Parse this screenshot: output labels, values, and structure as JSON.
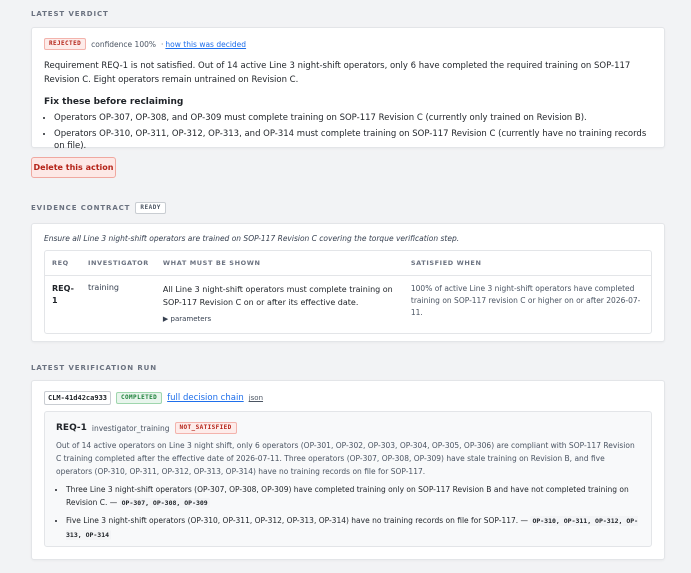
{
  "latest_verdict": {
    "section_label": "LATEST VERDICT",
    "status_pill": "REJECTED",
    "confidence": "confidence 100%",
    "separator": "·",
    "how_decided_link": "how this was decided",
    "summary": "Requirement REQ-1 is not satisfied. Out of 14 active Line 3 night-shift operators, only 6 have completed the required training on SOP-117 Revision C. Eight operators remain untrained on Revision C.",
    "fix_heading": "Fix these before reclaiming",
    "fix_items": [
      "Operators OP-307, OP-308, and OP-309 must complete training on SOP-117 Revision C (currently only trained on Revision B).",
      "Operators OP-310, OP-311, OP-312, OP-313, and OP-314 must complete training on SOP-117 Revision C (currently have no training records on file)."
    ],
    "delete_button": "Delete this action"
  },
  "evidence_contract": {
    "section_label": "EVIDENCE CONTRACT",
    "status_pill": "READY",
    "description": "Ensure all Line 3 night-shift operators are trained on SOP-117 Revision C covering the torque verification step.",
    "columns": [
      "REQ",
      "INVESTIGATOR",
      "WHAT MUST BE SHOWN",
      "SATISFIED WHEN"
    ],
    "rows": [
      {
        "req": "REQ-1",
        "investigator": "training",
        "what": "All Line 3 night-shift operators must complete training on SOP-117 Revision C on or after its effective date.",
        "params": "▶ parameters",
        "satisfied": "100% of active Line 3 night-shift operators have completed training on SOP-117 revision C or higher on or after 2026-07-11."
      }
    ]
  },
  "verification_run": {
    "section_label": "LATEST VERIFICATION RUN",
    "run_id": "CLM-41d42ca933",
    "status_pill": "COMPLETED",
    "decision_chain_link": "full decision chain",
    "json_link": "json",
    "result": {
      "req": "REQ-1",
      "investigator": "investigator_training",
      "status_pill": "NOT_SATISFIED",
      "summary": "Out of 14 active operators on Line 3 night shift, only 6 operators (OP-301, OP-302, OP-303, OP-304, OP-305, OP-306) are compliant with SOP-117 Revision C training completed after the effective date of 2026-07-11. Three operators (OP-307, OP-308, OP-309) have stale training on Revision B, and five operators (OP-310, OP-311, OP-312, OP-313, OP-314) have no training records on file for SOP-117.",
      "findings": [
        {
          "text": "Three Line 3 night-shift operators (OP-307, OP-308, OP-309) have completed training only on SOP-117 Revision B and have not completed training on Revision C. —",
          "refs": "OP-307, OP-308, OP-309"
        },
        {
          "text": "Five Line 3 night-shift operators (OP-310, OP-311, OP-312, OP-313, OP-314) have no training records on file for SOP-117. —",
          "refs": "OP-310, OP-311, OP-312, OP-313, OP-314"
        }
      ]
    }
  }
}
